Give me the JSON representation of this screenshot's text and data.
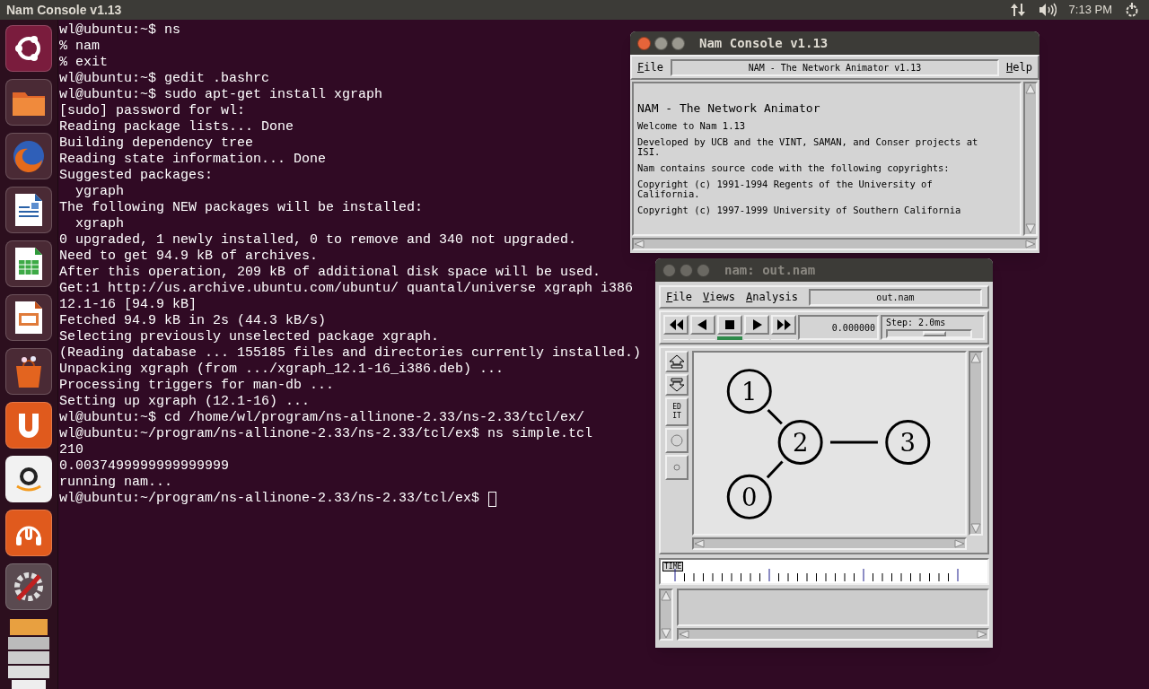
{
  "top_bar": {
    "title": "Nam Console v1.13",
    "clock": "7:13 PM"
  },
  "terminal": {
    "lines": [
      "wl@ubuntu:~$ ns",
      "% nam",
      "% exit",
      "wl@ubuntu:~$ gedit .bashrc",
      "wl@ubuntu:~$ sudo apt-get install xgraph",
      "[sudo] password for wl:",
      "Reading package lists... Done",
      "Building dependency tree",
      "Reading state information... Done",
      "Suggested packages:",
      "  ygraph",
      "The following NEW packages will be installed:",
      "  xgraph",
      "0 upgraded, 1 newly installed, 0 to remove and 340 not upgraded.",
      "Need to get 94.9 kB of archives.",
      "After this operation, 209 kB of additional disk space will be used.",
      "Get:1 http://us.archive.ubuntu.com/ubuntu/ quantal/universe xgraph i386",
      "12.1-16 [94.9 kB]",
      "Fetched 94.9 kB in 2s (44.3 kB/s)",
      "Selecting previously unselected package xgraph.",
      "(Reading database ... 155185 files and directories currently installed.)",
      "Unpacking xgraph (from .../xgraph_12.1-16_i386.deb) ...",
      "Processing triggers for man-db ...",
      "Setting up xgraph (12.1-16) ...",
      "wl@ubuntu:~$ cd /home/wl/program/ns-allinone-2.33/ns-2.33/tcl/ex/",
      "wl@ubuntu:~/program/ns-allinone-2.33/ns-2.33/tcl/ex$ ns simple.tcl",
      "210",
      "0.0037499999999999999",
      "running nam...",
      "wl@ubuntu:~/program/ns-allinone-2.33/ns-2.33/tcl/ex$ "
    ],
    "cursor": true
  },
  "console_window": {
    "title": "Nam Console v1.13",
    "active": true,
    "menus": [
      "File",
      "Help"
    ],
    "banner": "NAM - The Network Animator v1.13",
    "heading": "NAM - The Network Animator",
    "paragraphs": [
      "Welcome to Nam 1.13",
      "Developed by UCB and the VINT, SAMAN, and Conser projects at ISI.",
      "Nam contains source code with the following copyrights:",
      "Copyright (c) 1991-1994 Regents of the University of California.",
      "Copyright (c) 1997-1999 University of Southern California"
    ]
  },
  "nam_window": {
    "title": "nam: out.nam",
    "active": false,
    "menus": [
      "File",
      "Views",
      "Analysis"
    ],
    "file": "out.nam",
    "transport": [
      {
        "kind": "rewind",
        "selected": false
      },
      {
        "kind": "back",
        "selected": false
      },
      {
        "kind": "stop",
        "selected": true
      },
      {
        "kind": "play",
        "selected": false
      },
      {
        "kind": "forward",
        "selected": false
      }
    ],
    "time": "0.000000",
    "step": {
      "label": "Step: 2.0ms",
      "level": 0.55
    },
    "edit_button": "EDIT",
    "nodes": [
      {
        "label": "1"
      },
      {
        "label": "2"
      },
      {
        "label": "3"
      },
      {
        "label": "0"
      }
    ],
    "timeline_label": "TIME"
  }
}
